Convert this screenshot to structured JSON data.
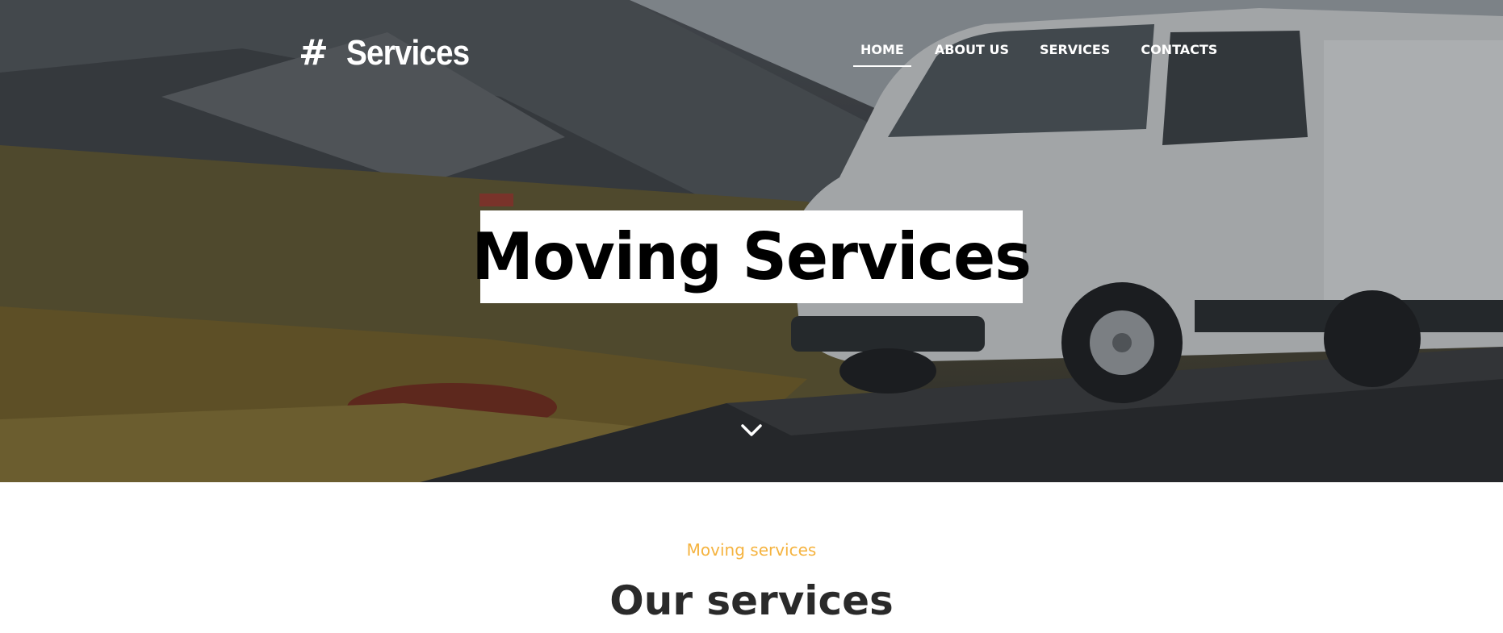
{
  "header": {
    "logo_icon": "hash-icon",
    "logo_symbol": "#",
    "logo_text": "Services"
  },
  "nav": {
    "items": [
      {
        "label": "HOME",
        "active": true
      },
      {
        "label": "ABOUT US",
        "active": false
      },
      {
        "label": "SERVICES",
        "active": false
      },
      {
        "label": "CONTACTS",
        "active": false
      }
    ]
  },
  "hero": {
    "headline": "Moving Services",
    "scroll_icon": "chevron-down-icon"
  },
  "intro": {
    "eyebrow": "Moving services",
    "title": "Our services"
  },
  "colors": {
    "accent": "#f5b33f",
    "nav_text": "#ffffff",
    "title_text": "#2a2a2a",
    "headline_bg": "#ffffff"
  }
}
